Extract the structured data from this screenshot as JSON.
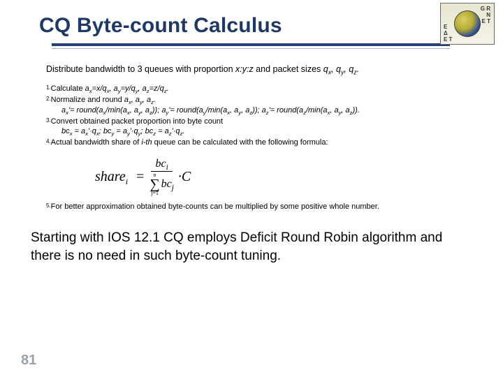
{
  "title": "CQ Byte-count Calculus",
  "intro_prefix": "Distribute bandwidth to 3 queues with proportion ",
  "intro_ratio": "x:y:z",
  "intro_mid": " and packet sizes ",
  "intro_q": "q",
  "step1_n": "1.",
  "step1_a": "Calculate ",
  "step1_b": "a",
  "step1_c": "=x/q",
  "step1_d": ", a",
  "step1_e": "=y/q",
  "step1_f": ", a",
  "step1_g": "=z/q",
  "step1_h": ".",
  "step2_n": "2.",
  "step2_a": "Normalize and round ",
  "step2_b": "a",
  "step2_c": ", a",
  "step2_d": ", a",
  "step2_e": ".",
  "step2_line2": "a",
  "step2_line2b": "'= round(a",
  "step2_line2c": "/min(a",
  "step2_line2d": ", a",
  "step2_line2e": ", a",
  "step2_line2f": ")); a",
  "step2_line2g": "'= round(a",
  "step2_line2h": "/min(a",
  "step2_line2i": ", a",
  "step2_line2j": ", a",
  "step2_line2k": ")); a",
  "step2_line2l": "'= round(a",
  "step2_line2m": "/min(a",
  "step2_line2n": ", a",
  "step2_line2o": ", a",
  "step2_line2p": ")).",
  "step3_n": "3.",
  "step3_a": "Convert obtained packet proportion into byte count",
  "step3_line2a": "bc",
  "step3_line2b": " = a",
  "step3_line2c": "'·q",
  "step3_line2d": "; bc",
  "step3_line2e": " = a",
  "step3_line2f": "'·q",
  "step3_line2g": "; bc",
  "step3_line2h": " = a",
  "step3_line2i": "'·q",
  "step3_line2j": ".",
  "step4_n": "4.",
  "step4_a": "Actual bandwidth share of ",
  "step4_b": "i-th",
  "step4_c": " queue can be calculated with the following formula:",
  "formula_lhs": "share",
  "formula_bc": "bc",
  "formula_n": "n",
  "formula_j1": "j=1",
  "formula_j": "j",
  "formula_i": "i",
  "formula_C": "·C",
  "step5_n": "5.",
  "step5_a": "For better approximation obtained byte-counts can be multiplied by some positive whole number.",
  "callout": "Starting with IOS 12.1 CQ employs Deficit Round Robin algorithm and there is no need in such byte-count tuning.",
  "page_num": "81",
  "sub_x": "x",
  "sub_y": "y",
  "sub_z": "z"
}
